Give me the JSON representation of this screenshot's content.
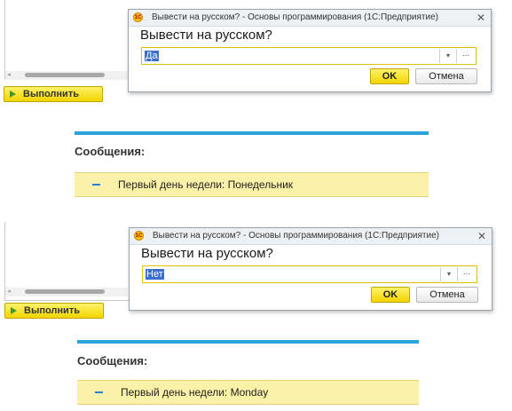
{
  "scenarios": [
    {
      "run_button_label": "Выполнить",
      "dialog": {
        "title": "Вывести на русском? - Основы программирования  (1С:Предприятие)",
        "heading": "Вывести на русском?",
        "value": "Да",
        "ok_label": "OK",
        "cancel_label": "Отмена"
      },
      "messages_label": "Сообщения:",
      "message_text": "Первый день недели: Понедельник"
    },
    {
      "run_button_label": "Выполнить",
      "dialog": {
        "title": "Вывести на русском? - Основы программирования  (1С:Предприятие)",
        "heading": "Вывести на русском?",
        "value": "Нет",
        "ok_label": "OK",
        "cancel_label": "Отмена"
      },
      "messages_label": "Сообщения:",
      "message_text": "Первый день недели: Monday"
    }
  ],
  "icons": {
    "logo": "1c-logo-icon",
    "run": "play-icon",
    "close": "close-icon",
    "dropdown": "chevron-down-icon",
    "select": "ellipsis-icon"
  },
  "colors": {
    "accent_yellow": "#f2d400",
    "message_bg": "#fbf1a8",
    "separator_blue": "#2aa5dc",
    "selection_blue": "#3a6fd0"
  }
}
